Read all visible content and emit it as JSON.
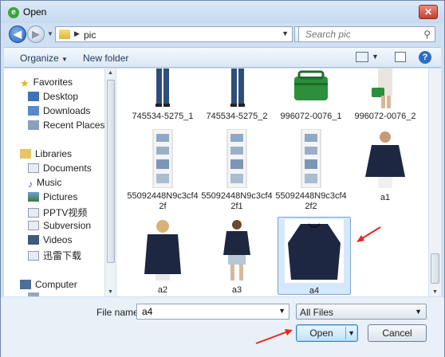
{
  "window": {
    "title": "Open"
  },
  "address": {
    "path_segment": "pic"
  },
  "search": {
    "placeholder": "Search pic"
  },
  "toolbar": {
    "organize": "Organize",
    "organize_arrow": "▼",
    "new_folder": "New folder"
  },
  "nav": {
    "favorites": "Favorites",
    "desktop": "Desktop",
    "downloads": "Downloads",
    "recent_places": "Recent Places",
    "libraries": "Libraries",
    "documents": "Documents",
    "music": "Music",
    "pictures": "Pictures",
    "pptv": "PPTV视频",
    "subversion": "Subversion",
    "videos": "Videos",
    "xunlei": "迅雷下载",
    "computer": "Computer"
  },
  "files": [
    {
      "name": "745534-5275_1"
    },
    {
      "name": "745534-5275_2"
    },
    {
      "name": "996072-0076_1"
    },
    {
      "name": "996072-0076_2"
    },
    {
      "name_line1": "55092448N9c3cf4",
      "name_line2": "2f"
    },
    {
      "name_line1": "55092448N9c3cf4",
      "name_line2": "2f1"
    },
    {
      "name_line1": "55092448N9c3cf4",
      "name_line2": "2f2"
    },
    {
      "name": "a1"
    },
    {
      "name": "a2"
    },
    {
      "name": "a3"
    },
    {
      "name": "a4"
    }
  ],
  "footer": {
    "file_name_label": "File name:",
    "file_name_value": "a4",
    "file_type": "All Files",
    "open_button": "Open",
    "cancel_button": "Cancel"
  },
  "colors": {
    "selection": "#d5e8fb",
    "arrow": "#e8261b",
    "sweater": "#1d2741"
  }
}
